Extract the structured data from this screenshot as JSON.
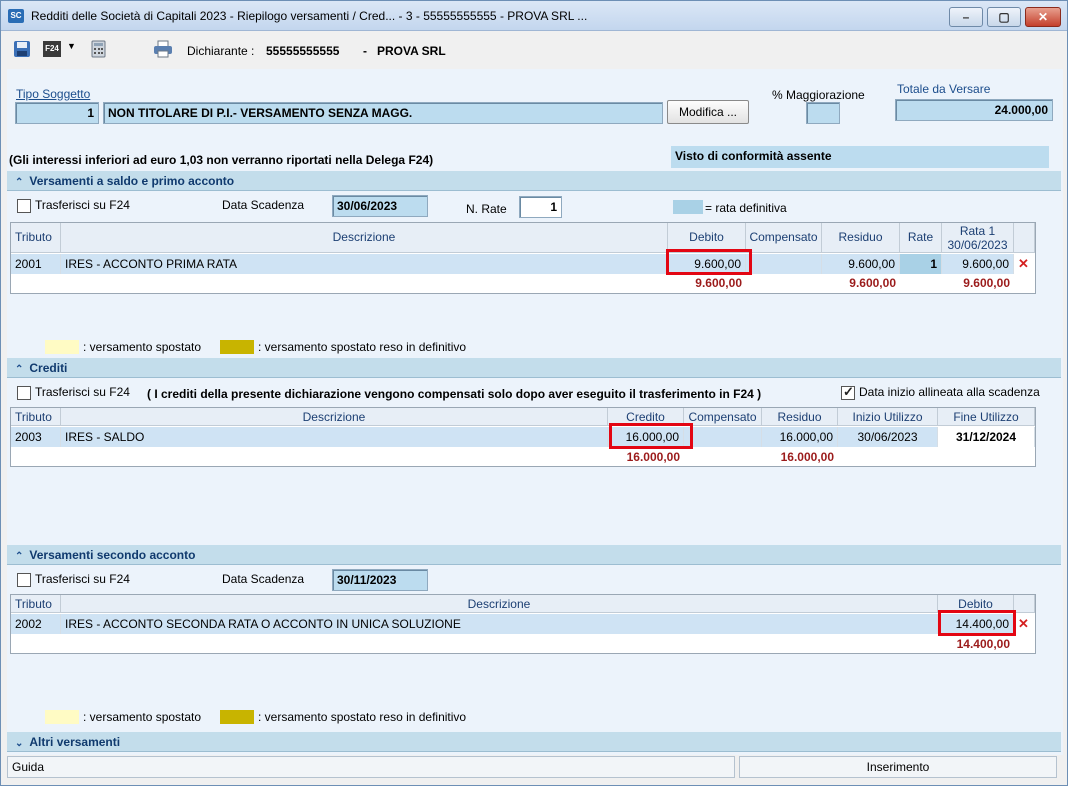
{
  "window": {
    "icon_text": "SC",
    "title": "Redditi delle Società di Capitali 2023 - Riepilogo versamenti / Cred... - 3 - 55555555555 - PROVA SRL ...",
    "minimize": "–",
    "maximize": "▢",
    "close": "✕"
  },
  "toolbar": {
    "f24_label": "F24",
    "dichiarante_label": "Dichiarante :",
    "dichiarante_cf": "55555555555",
    "separator": "-",
    "dichiarante_name": "PROVA SRL"
  },
  "header": {
    "tipo_soggetto_label": "Tipo Soggetto",
    "tipo_soggetto_code": "1",
    "tipo_soggetto_desc": "NON TITOLARE DI P.I.- VERSAMENTO SENZA MAGG.",
    "modifica_button": "Modifica ...",
    "maggiorazione_label": "% Maggiorazione",
    "maggiorazione_value": "",
    "totale_label": "Totale da Versare",
    "totale_value": "24.000,00",
    "interessi_note": "(Gli interessi inferiori ad euro 1,03 non verranno riportati nella Delega F24)",
    "visto_text": "Visto di conformità assente"
  },
  "section1": {
    "title": "Versamenti a saldo e primo acconto",
    "trasferisci_label": "Trasferisci su F24",
    "data_scadenza_label": "Data Scadenza",
    "data_scadenza_value": "30/06/2023",
    "n_rate_label": "N. Rate",
    "n_rate_value": "1",
    "rata_definitiva_label": "= rata definitiva",
    "columns": [
      "Tributo",
      "Descrizione",
      "Debito",
      "Compensato",
      "Residuo",
      "Rate",
      "Rata 1",
      "30/06/2023"
    ],
    "rows": [
      {
        "tributo": "2001",
        "descrizione": "IRES - ACCONTO PRIMA RATA",
        "debito": "9.600,00",
        "compensato": "",
        "residuo": "9.600,00",
        "rate": "1",
        "rata1": "9.600,00"
      }
    ],
    "totals": {
      "debito": "9.600,00",
      "residuo": "9.600,00",
      "rata1": "9.600,00"
    },
    "legend_spostato": ": versamento spostato",
    "legend_definitivo": ": versamento spostato reso in definitivo"
  },
  "section2": {
    "title": "Crediti",
    "trasferisci_label": "Trasferisci su F24",
    "note": "( I crediti della presente dichiarazione vengono compensati solo dopo aver eseguito il trasferimento in F24 )",
    "allinea_label": "Data inizio allineata alla scadenza",
    "columns": [
      "Tributo",
      "Descrizione",
      "Credito",
      "Compensato",
      "Residuo",
      "Inizio Utilizzo",
      "Fine Utilizzo"
    ],
    "rows": [
      {
        "tributo": "2003",
        "descrizione": "IRES - SALDO",
        "credito": "16.000,00",
        "compensato": "",
        "residuo": "16.000,00",
        "inizio": "30/06/2023",
        "fine": "31/12/2024"
      }
    ],
    "totals": {
      "credito": "16.000,00",
      "residuo": "16.000,00"
    }
  },
  "section3": {
    "title": "Versamenti secondo acconto",
    "trasferisci_label": "Trasferisci su F24",
    "data_scadenza_label": "Data Scadenza",
    "data_scadenza_value": "30/11/2023",
    "columns": [
      "Tributo",
      "Descrizione",
      "Debito"
    ],
    "rows": [
      {
        "tributo": "2002",
        "descrizione": "IRES - ACCONTO SECONDA RATA O ACCONTO IN UNICA SOLUZIONE",
        "debito": "14.400,00"
      }
    ],
    "totals": {
      "debito": "14.400,00"
    },
    "legend_spostato": ": versamento spostato",
    "legend_definitivo": ": versamento spostato reso in definitivo"
  },
  "section4": {
    "title": "Altri versamenti"
  },
  "statusbar": {
    "left": "Guida",
    "right": "Inserimento"
  },
  "colors": {
    "section_header": "#c3ddeb",
    "field_bg": "#bcdcef",
    "total_text": "#9b1b1b",
    "highlight": "#e30613",
    "legend_spostato": "#fffbc4",
    "legend_definitivo": "#c8b400"
  }
}
